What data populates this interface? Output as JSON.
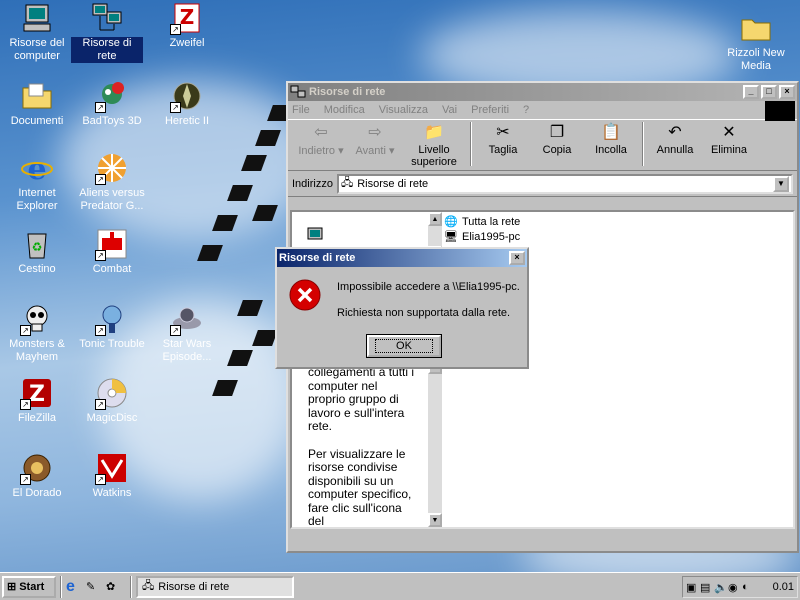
{
  "desktop": {
    "icons": [
      {
        "label": "Risorse del computer",
        "icon": "my-computer-icon"
      },
      {
        "label": "Risorse di rete",
        "icon": "network-neighborhood-icon"
      },
      {
        "label": "Zweifel",
        "icon": "zweifel-icon"
      },
      {
        "label": "Rizzoli New Media",
        "icon": "folder-icon"
      },
      {
        "label": "Documenti",
        "icon": "folder-icon"
      },
      {
        "label": "BadToys 3D",
        "icon": "badtoys-icon"
      },
      {
        "label": "Heretic II",
        "icon": "heretic-icon"
      },
      {
        "label": "Internet Explorer",
        "icon": "internet-explorer-icon"
      },
      {
        "label": "Aliens versus Predator G...",
        "icon": "aliens-icon"
      },
      {
        "label": "Cestino",
        "icon": "recycle-bin-icon"
      },
      {
        "label": "Combat",
        "icon": "combat-icon"
      },
      {
        "label": "Monsters & Mayhem",
        "icon": "skull-icon"
      },
      {
        "label": "Tonic Trouble",
        "icon": "tonic-trouble-icon"
      },
      {
        "label": "Star Wars Episode...",
        "icon": "star-wars-icon"
      },
      {
        "label": "FileZilla",
        "icon": "filezilla-icon"
      },
      {
        "label": "MagicDisc",
        "icon": "magicdisc-icon"
      },
      {
        "label": "El Dorado",
        "icon": "el-dorado-icon"
      },
      {
        "label": "Watkins",
        "icon": "watkins-icon"
      }
    ]
  },
  "explorer": {
    "title": "Risorse di rete",
    "menu": [
      "File",
      "Modifica",
      "Visualizza",
      "Vai",
      "Preferiti",
      "?"
    ],
    "toolbar": {
      "back": "Indietro",
      "forward": "Avanti",
      "up": "Livello superiore",
      "cut": "Taglia",
      "copy": "Copia",
      "paste": "Incolla",
      "undo": "Annulla",
      "delete": "Elimina"
    },
    "address_label": "Indirizzo",
    "address_value": "Risorse di rete",
    "items": [
      "Tutta la rete",
      "Elia1995-pc"
    ],
    "info_text_1": "collegamenti a tutti i computer nel proprio gruppo di lavoro e sull'intera rete.",
    "info_text_2": "Per visualizzare le risorse condivise disponibili su un computer specifico, fare clic sull'icona del"
  },
  "dialog": {
    "title": "Risorse di rete",
    "message_1": "Impossibile accedere a \\\\Elia1995-pc.",
    "message_2": "Richiesta non supportata dalla rete.",
    "ok_label": "OK"
  },
  "taskbar": {
    "start_label": "Start",
    "task_label": "Risorse di rete",
    "clock": "0.01"
  },
  "colors": {
    "active_title": "#0a246a",
    "error_red": "#d40000",
    "face": "#c0c0c0"
  }
}
